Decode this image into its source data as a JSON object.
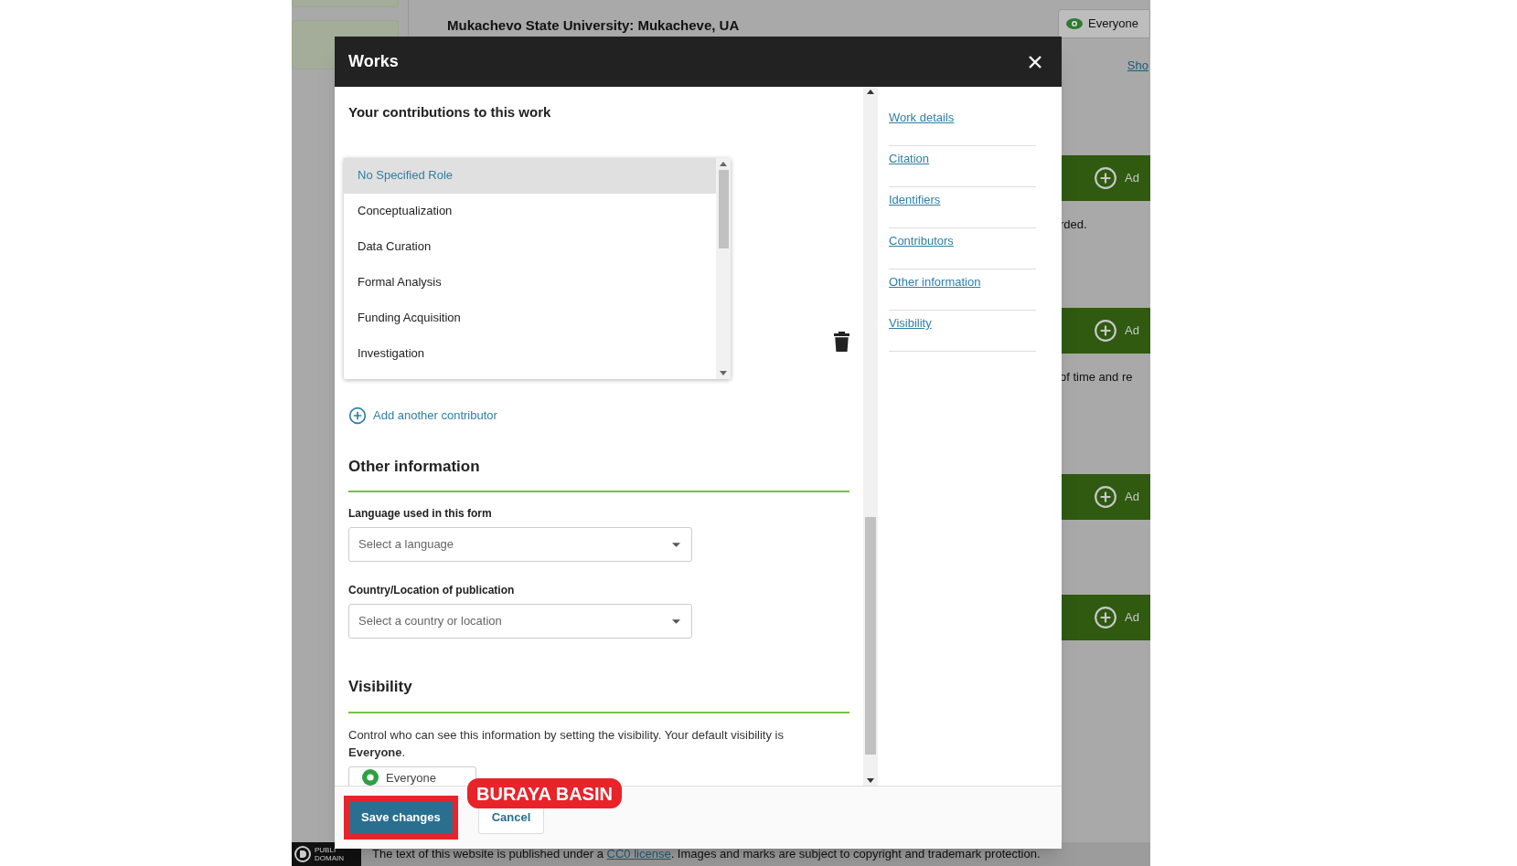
{
  "background_page": {
    "title": "Mukachevo State University: Mukacheve, UA",
    "visibility_badge": "Everyone",
    "link": "Sho",
    "add_buttons": [
      "Ad",
      "Ad",
      "Ad",
      "Ad"
    ],
    "texts": [
      "rded.",
      "of time and re"
    ]
  },
  "modal": {
    "title": "Works",
    "section_heading": "Your contributions to this work",
    "roles": [
      {
        "label": "No Specified Role",
        "selected": true
      },
      {
        "label": "Conceptualization",
        "selected": false
      },
      {
        "label": "Data Curation",
        "selected": false
      },
      {
        "label": "Formal Analysis",
        "selected": false
      },
      {
        "label": "Funding Acquisition",
        "selected": false
      },
      {
        "label": "Investigation",
        "selected": false
      }
    ],
    "add_contributor": "Add another contributor",
    "other_information": {
      "heading": "Other information",
      "fields": [
        {
          "label": "Language used in this form",
          "placeholder": "Select a language"
        },
        {
          "label": "Country/Location of publication",
          "placeholder": "Select a country or location"
        }
      ]
    },
    "visibility": {
      "heading": "Visibility",
      "description": "Control who can see this information by setting the visibility. Your default visibility is **Everyone**.",
      "dropdown": "Everyone"
    },
    "nav": [
      "Work details",
      "Citation",
      "Identifiers",
      "Contributors",
      "Other information",
      "Visibility"
    ],
    "buttons": {
      "save": "Save changes",
      "cancel": "Cancel"
    },
    "annotation": "BURAYA BASIN"
  },
  "footer_notice": {
    "badge": [
      "PUBLI",
      "DOMAIN"
    ],
    "text_before": "The text of this website is published under a ",
    "link": "CC0 license",
    "text_after": ". Images and marks are subject to copyright and trademark protection."
  }
}
